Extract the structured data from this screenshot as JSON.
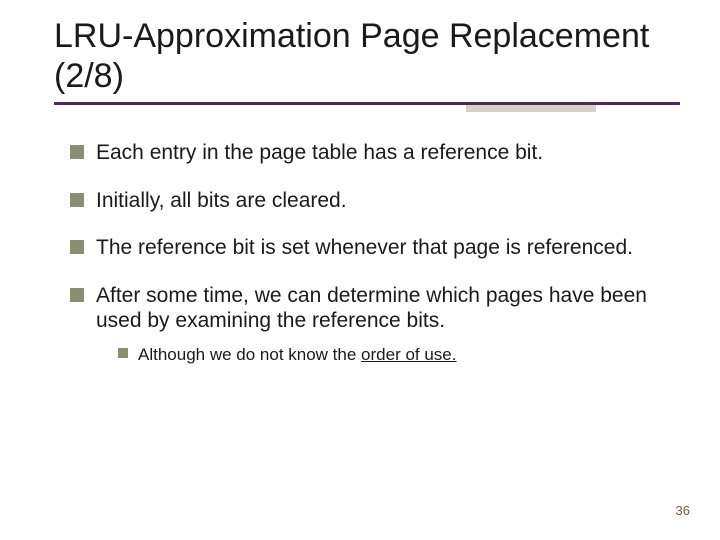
{
  "title": "LRU-Approximation Page Replacement (2/8)",
  "bullets": [
    {
      "text": "Each entry in the page table has a reference bit."
    },
    {
      "text": "Initially, all bits are cleared."
    },
    {
      "text": "The reference bit is set whenever that page is referenced."
    },
    {
      "text": "After some time, we can determine which pages have been used by examining the reference bits.",
      "sub": [
        {
          "prefix": "Although we do not know the ",
          "order_phrase": "order of use."
        }
      ]
    }
  ],
  "page_number": "36"
}
